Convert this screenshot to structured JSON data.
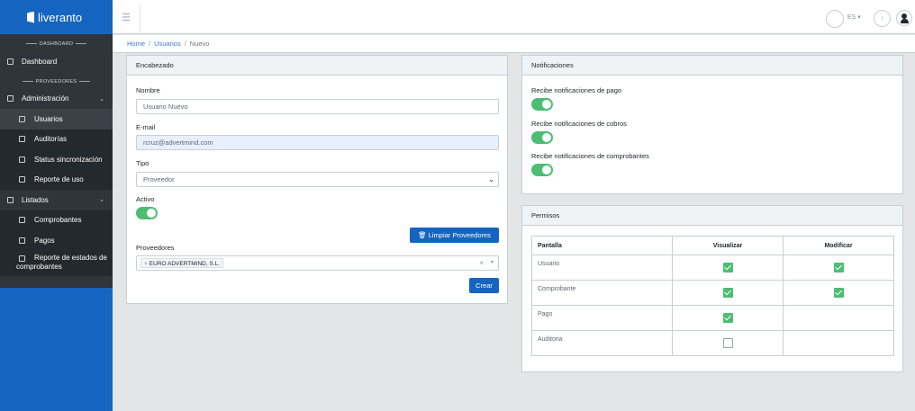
{
  "brand": {
    "name": "liveranto"
  },
  "sidebar": {
    "section_dashboard": "DASHBOARD",
    "dashboard": "Dashboard",
    "section_proveedores": "PROVEEDORES",
    "administracion": "Administración",
    "usuarios": "Usuarios",
    "auditorias": "Auditorías",
    "status": "Status sincronización",
    "reporte_uso": "Reporte de uso",
    "listados": "Listados",
    "comprobantes": "Comprobantes",
    "pagos": "Pagos",
    "reporte_estados": "Reporte de estados de comprobantes"
  },
  "topbar": {
    "lang": "ES ▾"
  },
  "breadcrumb": {
    "home": "Home",
    "usuarios": "Usuarios",
    "current": "Nuevo"
  },
  "form": {
    "header": "Encabezado",
    "nombre_label": "Nombre",
    "nombre_value": "Usuario Nuevo",
    "email_label": "E-mail",
    "email_value": "rcruz@advertmind.com",
    "tipo_label": "Tipo",
    "tipo_value": "Proveedor",
    "activo_label": "Activo",
    "activo_on": true,
    "limpiar_label": "Limpiar Proveedores",
    "proveedores_label": "Proveedores",
    "proveedor_tag": "EURO ADVERTMIND, S.L.",
    "crear_label": "Crear"
  },
  "notificaciones": {
    "header": "Notificaciones",
    "pago": "Recibe notificaciones de pago",
    "cobros": "Recibe notificaciones de cobros",
    "comprobantes": "Recibe notificaciones de comprobantes",
    "pago_on": true,
    "cobros_on": true,
    "comprobantes_on": true
  },
  "permisos": {
    "header": "Permisos",
    "columns": [
      "Pantalla",
      "Visualizar",
      "Modificar"
    ],
    "rows": [
      {
        "pantalla": "Usuario",
        "visualizar": true,
        "modificar": true
      },
      {
        "pantalla": "Comprobante",
        "visualizar": true,
        "modificar": true
      },
      {
        "pantalla": "Pago",
        "visualizar": true,
        "modificar": null
      },
      {
        "pantalla": "Auditoria",
        "visualizar": false,
        "modificar": null
      }
    ]
  },
  "colors": {
    "brand": "#1565c0",
    "sidebar": "#2f353a",
    "success": "#4dbd74"
  }
}
